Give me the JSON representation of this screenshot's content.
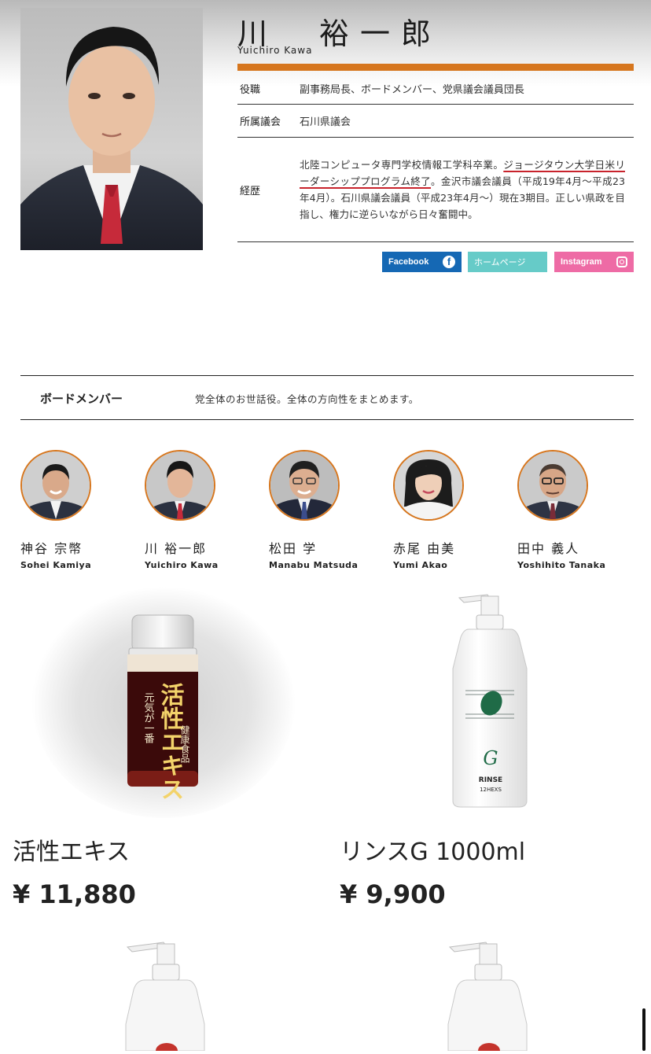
{
  "profile": {
    "name": "川　裕一郎",
    "name_roman": "Yuichiro Kawa",
    "rows": [
      {
        "label": "役職",
        "value": "副事務局長、ボードメンバー、党県議会議員団長"
      },
      {
        "label": "所属議会",
        "value": "石川県議会"
      },
      {
        "label": "経歴",
        "value_before": "北陸コンピュータ専門学校情報工学科卒業。",
        "value_underlined": "ジョージタウン大学日米リーダーシッププログラム終了",
        "value_after": "。金沢市議会議員（平成19年4月〜平成23年4月）。石川県議会議員（平成23年4月〜）現在3期目。正しい県政を目指し、権力に逆らいながら日々奮闘中。"
      }
    ]
  },
  "sns": {
    "facebook": "Facebook",
    "homepage": "ホームページ",
    "instagram": "Instagram"
  },
  "board": {
    "title": "ボードメンバー",
    "description": "党全体のお世話役。全体の方向性をまとめます。",
    "members": [
      {
        "name": "神谷 宗幣",
        "roman": "Sohei Kamiya"
      },
      {
        "name": "川 裕一郎",
        "roman": "Yuichiro Kawa"
      },
      {
        "name": "松田 学",
        "roman": "Manabu Matsuda"
      },
      {
        "name": "赤尾 由美",
        "roman": "Yumi Akao"
      },
      {
        "name": "田中 義人",
        "roman": "Yoshihito Tanaka"
      }
    ]
  },
  "products": [
    {
      "name": "活性エキス",
      "price": "¥ 11,880",
      "label_lines": [
        "元気が一番",
        "活性エキス",
        "健康食品"
      ]
    },
    {
      "name": "リンスG 1000ml",
      "price": "¥ 9,900",
      "label_logo": "G",
      "label_type": "RINSE",
      "label_brand": "12HEXS"
    }
  ],
  "colors": {
    "accent": "#d6761e",
    "facebook": "#1568b4",
    "homepage": "#66cbc8",
    "instagram": "#ee6ba5",
    "underline": "#c8232c"
  }
}
